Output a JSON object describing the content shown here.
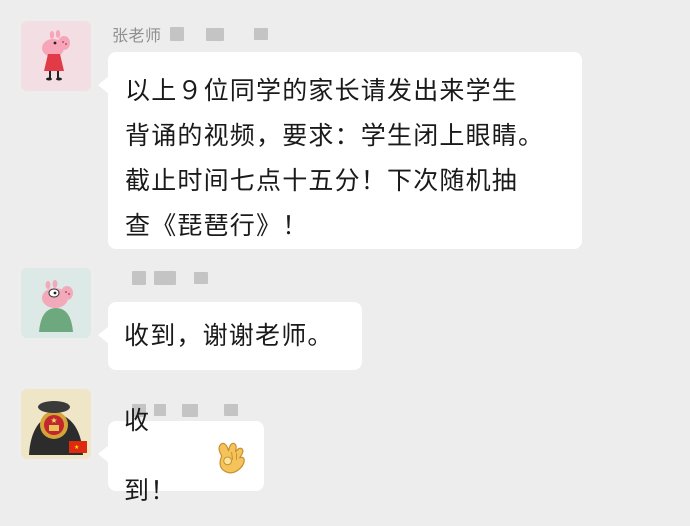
{
  "messages": [
    {
      "sender": "张老师",
      "avatar_icon": "peppa-pig-icon",
      "lines": [
        "以上９位同学的家长请发出来学生",
        "背诵的视频，要求：学生闭上眼睛。",
        "截止时间七点十五分！下次随机抽",
        "查《琵琶行》！"
      ]
    },
    {
      "avatar_icon": "george-pig-icon",
      "text": "收到，谢谢老师。"
    },
    {
      "avatar_icon": "national-emblem-icon",
      "text": "收到！",
      "emoji_icon": "ok-hand-icon"
    }
  ],
  "colors": {
    "background": "#ededed",
    "bubble": "#ffffff",
    "text": "#1a1a1a",
    "sender_name": "#8f8f8f"
  }
}
